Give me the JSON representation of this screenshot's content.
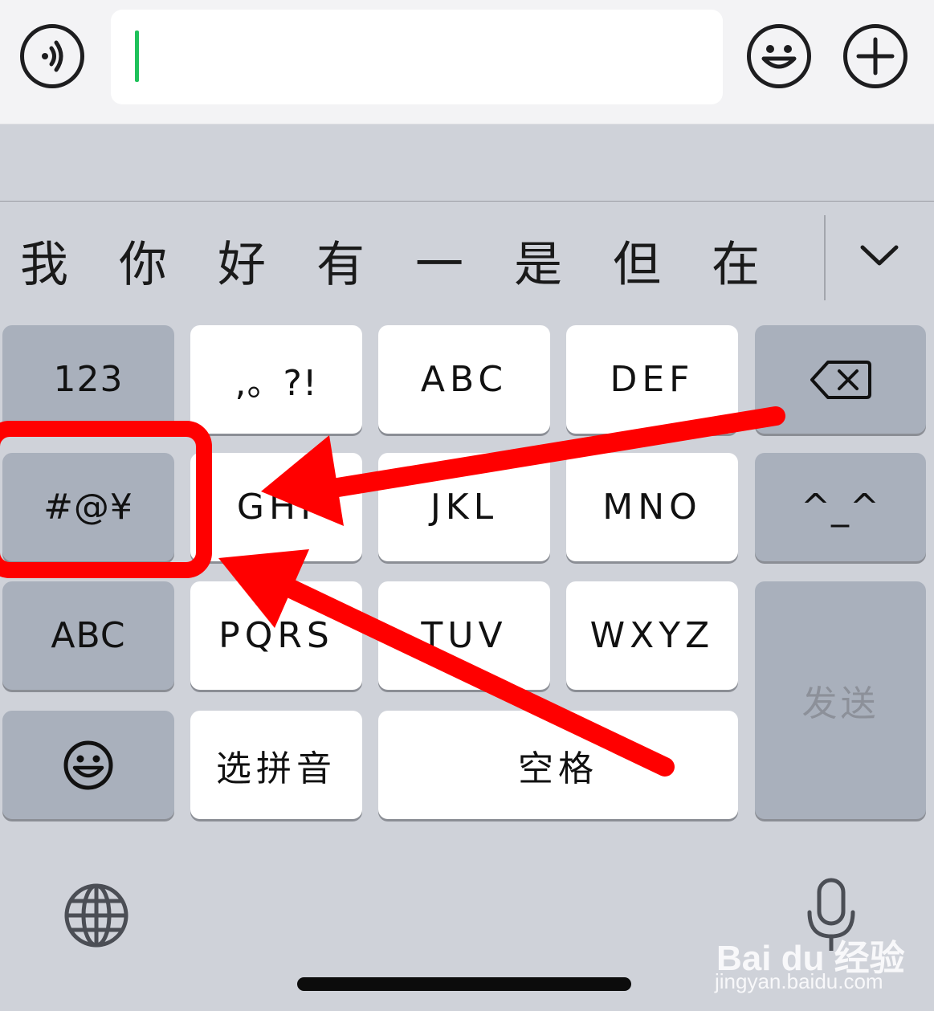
{
  "input_bar": {
    "voice_icon": "voice-wave-icon",
    "emoji_icon": "smiley-icon",
    "add_icon": "plus-icon",
    "input_value": ""
  },
  "candidates": [
    "我",
    "你",
    "好",
    "有",
    "一",
    "是",
    "但",
    "在"
  ],
  "keys": {
    "numbers": "123",
    "punct": ",。?!",
    "abc2": "ABC",
    "def3": "DEF",
    "symbols": "#@¥",
    "ghi": "GHI",
    "jkl": "JKL",
    "mno": "MNO",
    "kaomoji": "^_^",
    "abc_mode": "ABC",
    "pqrs": "PQRS",
    "tuv": "TUV",
    "wxyz": "WXYZ",
    "send": "发送",
    "pinyin": "选拼音",
    "space": "空格"
  },
  "watermark": {
    "brand": "Bai du 经验",
    "url": "jingyan.baidu.com"
  },
  "colors": {
    "cursor": "#1ec15a",
    "annotation": "#ff0000",
    "key_light": "#ffffff",
    "key_dark": "#a9b0bc"
  }
}
